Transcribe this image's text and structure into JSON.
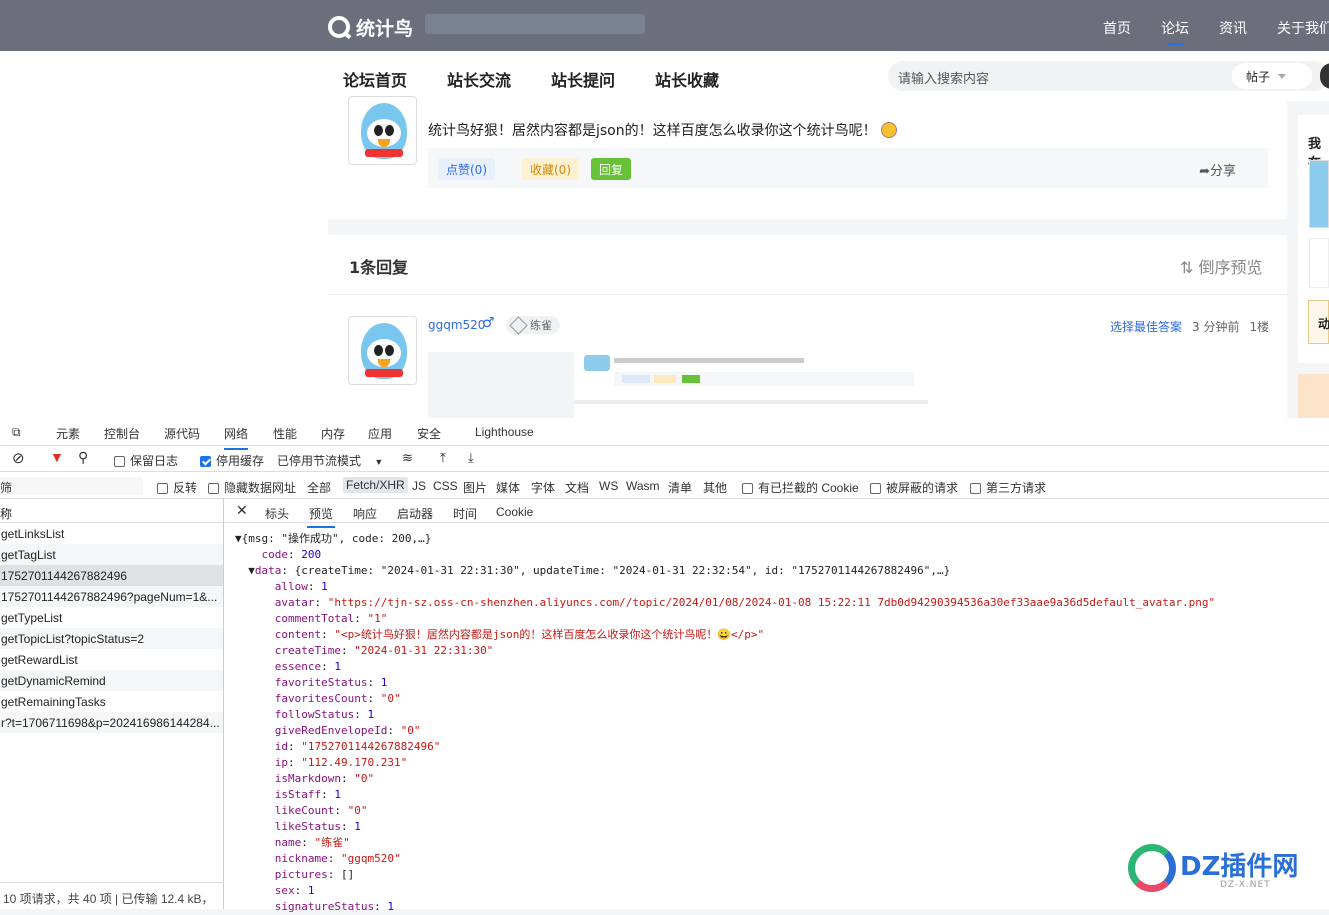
{
  "header": {
    "logo_text": "统计鸟",
    "nav": [
      "首页",
      "论坛",
      "资讯",
      "关于我们"
    ]
  },
  "subnav": [
    "论坛首页",
    "站长交流",
    "站长提问",
    "站长收藏"
  ],
  "search": {
    "placeholder": "请输入搜索内容",
    "type": "帖子"
  },
  "post": {
    "content": "统计鸟好狠！居然内容都是json的！这样百度怎么收录你这个统计鸟呢！",
    "like": "点赞(0)",
    "favorite": "收藏(0)",
    "reply": "回复",
    "share": "分享"
  },
  "replies": {
    "count_label": "1条回复",
    "sort_label": "倒序预览",
    "item": {
      "username": "ggqm520",
      "gender": "♂",
      "level": "练雀",
      "best": "选择最佳答案",
      "time": "3 分钟前",
      "floor": "1楼"
    }
  },
  "right": {
    "title": "我在",
    "btn": "动"
  },
  "devtools": {
    "tabs": [
      "元素",
      "控制台",
      "源代码",
      "网络",
      "性能",
      "内存",
      "应用",
      "安全",
      "Lighthouse"
    ],
    "toolbar": {
      "preserve_log": "保留日志",
      "disable_cache": "停用缓存",
      "throttle": "已停用节流模式"
    },
    "filter": {
      "input": "筛",
      "invert": "反转",
      "hide_data": "隐藏数据网址",
      "types": [
        "全部",
        "Fetch/XHR",
        "JS",
        "CSS",
        "图片",
        "媒体",
        "字体",
        "文档",
        "WS",
        "Wasm",
        "清单",
        "其他"
      ],
      "blocked_cookies": "有已拦截的 Cookie",
      "blocked_requests": "被屏蔽的请求",
      "third_party": "第三方请求"
    },
    "list_header": "称",
    "requests": [
      "getLinksList",
      "getTagList",
      "1752701144267882496",
      "1752701144267882496?pageNum=1&...",
      "getTypeList",
      "getTopicList?topicStatus=2",
      "getRewardList",
      "getDynamicRemind",
      "getRemainingTasks",
      "r?t=1706711698&p=202416986144284..."
    ],
    "status": "10 项请求，共 40 项  |  已传输 12.4 kB，",
    "detail_tabs": [
      "标头",
      "预览",
      "响应",
      "启动器",
      "时间",
      "Cookie"
    ],
    "json_lines": [
      "▼{msg: \"操作成功\", code: 200,…}",
      "    code: 200",
      "  ▼data: {createTime: \"2024-01-31 22:31:30\", updateTime: \"2024-01-31 22:32:54\", id: \"1752701144267882496\",…}",
      "      allow: 1",
      "      avatar: \"https://tjn-sz.oss-cn-shenzhen.aliyuncs.com//topic/2024/01/08/2024-01-08 15:22:11 7db0d94290394536a30ef33aae9a36d5default_avatar.png\"",
      "      commentTotal: \"1\"",
      "      content: \"<p>统计鸟好狠！居然内容都是json的！这样百度怎么收录你这个统计鸟呢！😀</p>\"",
      "      createTime: \"2024-01-31 22:31:30\"",
      "      essence: 1",
      "      favoriteStatus: 1",
      "      favoritesCount: \"0\"",
      "      followStatus: 1",
      "      giveRedEnvelopeId: \"0\"",
      "      id: \"1752701144267882496\"",
      "      ip: \"112.49.170.231\"",
      "      isMarkdown: \"0\"",
      "      isStaff: 1",
      "      likeCount: \"0\"",
      "      likeStatus: 1",
      "      name: \"练雀\"",
      "      nickname: \"ggqm520\"",
      "      pictures: []",
      "      sex: 1",
      "      signatureStatus: 1"
    ]
  },
  "watermark": {
    "text": "DZ插件网",
    "url": "DZ-X.NET"
  }
}
